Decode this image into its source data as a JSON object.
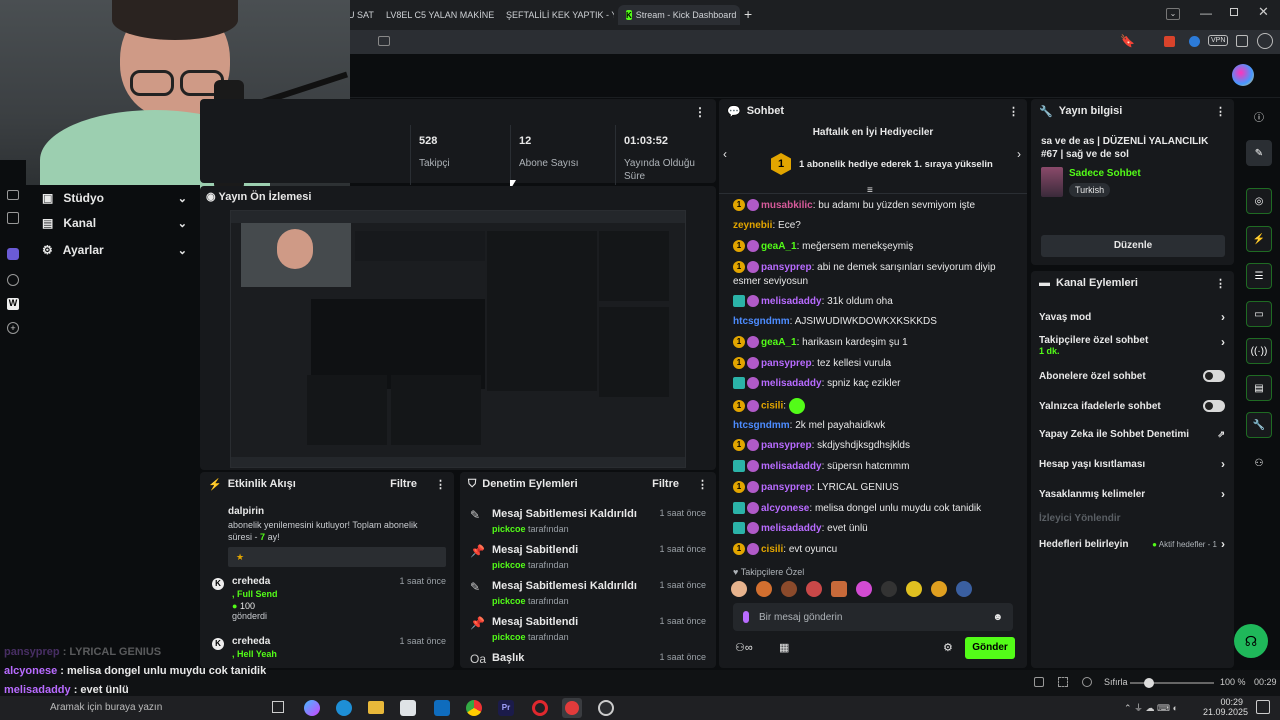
{
  "browser": {
    "tabs": [
      {
        "label": "U SAT"
      },
      {
        "label": "LV8EL C5 YALAN MAKİNESİ"
      },
      {
        "label": "ŞEFTALİLİ KEK YAPTIK - You"
      },
      {
        "label": "Stream - Kick Dashboard"
      }
    ],
    "new_tab": "+",
    "vpn_label": "VPN"
  },
  "sidenav": {
    "items": [
      {
        "label": "Stüdyo"
      },
      {
        "label": "Kanal"
      },
      {
        "label": "Ayarlar"
      }
    ]
  },
  "stats": {
    "items": [
      {
        "value": "528",
        "label": "Takipçi"
      },
      {
        "value": "12",
        "label": "Abone Sayısı"
      },
      {
        "value": "01:03:52",
        "label": "Yayında Olduğu Süre"
      }
    ]
  },
  "preview": {
    "title": "Yayın Ön İzlemesi"
  },
  "activity": {
    "title": "Etkinlik Akışı",
    "filter": "Filtre",
    "events": [
      {
        "user": "dalpirin",
        "text": "abonelik yenilemesini kutluyor! Toplam abonelik süresi -",
        "highlight": "7",
        "suffix": "ay!",
        "time": ""
      },
      {
        "user": "creheda",
        "sub": ", Full Send",
        "amount": "100",
        "amount_label": "gönderdi",
        "time": "1 saat önce"
      },
      {
        "user": "creheda",
        "sub": ", Hell Yeah",
        "time": "1 saat önce"
      }
    ]
  },
  "moderation": {
    "title": "Denetim Eylemleri",
    "filter": "Filtre",
    "actor": "pickcoe",
    "by": "tarafından",
    "items": [
      {
        "title": "Mesaj Sabitlemesi Kaldırıldı",
        "time": "1 saat önce"
      },
      {
        "title": "Mesaj Sabitlendi",
        "time": "1 saat önce"
      },
      {
        "title": "Mesaj Sabitlemesi Kaldırıldı",
        "time": "1 saat önce"
      },
      {
        "title": "Mesaj Sabitlendi",
        "time": "1 saat önce"
      },
      {
        "title": "Başlık",
        "time": "1 saat önce"
      }
    ]
  },
  "chat": {
    "title": "Sohbet",
    "gifters_title": "Haftalık en İyi Hediyeciler",
    "gift_badge": "1",
    "gift_prompt": "1 abonelik hediye ederek 1. sıraya yükselin",
    "messages": [
      {
        "badge": "sub",
        "user": "musabkilic",
        "color": "#d65a9a",
        "text": "bu adamı bu yüzden sevmiyom işte"
      },
      {
        "badge": "",
        "user": "zeynebii",
        "color": "#e2a500",
        "text": "Ece?"
      },
      {
        "badge": "sub",
        "user": "geaA_1",
        "color": "#53fc18",
        "text": "meğersem menekşeymiş"
      },
      {
        "badge": "sub",
        "user": "pansyprep",
        "color": "#b86bff",
        "text": "abi ne demek sarışınları seviyorum diyip esmer seviyosun"
      },
      {
        "badge": "mod",
        "user": "melisadaddy",
        "color": "#b86bff",
        "text": "31k oldum oha"
      },
      {
        "badge": "",
        "user": "htcsgndmm",
        "color": "#4d8cff",
        "text": "AJSIWUDIWKDOWKXKSKKDS"
      },
      {
        "badge": "sub",
        "user": "geaA_1",
        "color": "#53fc18",
        "text": "harikasın kardeşim şu 1"
      },
      {
        "badge": "sub",
        "user": "pansyprep",
        "color": "#b86bff",
        "text": "tez kellesi vurula"
      },
      {
        "badge": "mod",
        "user": "melisadaddy",
        "color": "#b86bff",
        "text": "spniz kaç ezikler"
      },
      {
        "badge": "sub",
        "user": "cisili",
        "color": "#e2a500",
        "text": ""
      },
      {
        "badge": "",
        "user": "htcsgndmm",
        "color": "#4d8cff",
        "text": "2k mel payahaidkwk"
      },
      {
        "badge": "sub",
        "user": "pansyprep",
        "color": "#b86bff",
        "text": "skdjyshdjksgdhsjklds"
      },
      {
        "badge": "mod",
        "user": "melisadaddy",
        "color": "#b86bff",
        "text": "süpersn hatcmmm"
      },
      {
        "badge": "sub",
        "user": "pansyprep",
        "color": "#b86bff",
        "text": "LYRICAL GENIUS"
      },
      {
        "badge": "mod",
        "user": "alcyonese",
        "color": "#b86bff",
        "text": "melisa dongel unlu muydu cok tanidik"
      },
      {
        "badge": "mod",
        "user": "melisadaddy",
        "color": "#b86bff",
        "text": "evet ünlü"
      },
      {
        "badge": "sub",
        "user": "cisili",
        "color": "#e2a500",
        "text": "evt oyuncu"
      }
    ],
    "followers_label": "Takipçilere Özel",
    "input_placeholder": "Bir mesaj gönderin",
    "send": "Gönder"
  },
  "stream_info": {
    "title": "Yayın bilgisi",
    "stream_title": "sa ve de as | DÜZENLİ YALANCILIK #67 | sağ ve de sol",
    "category": "Sadece Sohbet",
    "language": "Turkish",
    "edit": "Düzenle"
  },
  "channel_actions": {
    "title": "Kanal Eylemleri",
    "rows": [
      {
        "label": "Yavaş mod",
        "control": "chevron",
        "sub": ""
      },
      {
        "label": "Takipçilere özel sohbet",
        "control": "chevron",
        "sub": "1 dk."
      },
      {
        "label": "Abonelere özel sohbet",
        "control": "toggle",
        "sub": ""
      },
      {
        "label": "Yalnızca ifadelerle sohbet",
        "control": "toggle",
        "sub": ""
      },
      {
        "label": "Yapay Zeka ile Sohbet Denetimi",
        "control": "external",
        "sub": ""
      },
      {
        "label": "Hesap yaşı kısıtlaması",
        "control": "chevron",
        "sub": ""
      },
      {
        "label": "Yasaklanmış kelimeler",
        "control": "chevron",
        "sub": ""
      },
      {
        "label": "İzleyici Yönlendir",
        "control": "disabled",
        "sub": ""
      },
      {
        "label": "Hedefleri belirleyin",
        "control": "goals",
        "sub": ""
      }
    ],
    "goals_label": "Aktif hedefler - 1"
  },
  "overlay_chat": [
    {
      "user": "pansyprep",
      "text": "LYRICAL GENIUS"
    },
    {
      "user": "alcyonese",
      "text": "melisa dongel unlu muydu cok tanidik"
    },
    {
      "user": "melisadaddy",
      "text": "evet ünlü"
    },
    {
      "user": "cisili",
      "text": "evt oyuncu"
    }
  ],
  "status": {
    "reset": "Sıfırla",
    "zoom": "100 %",
    "time": "00:29"
  },
  "taskbar": {
    "search": "Aramak için buraya yazın",
    "time": "00:29",
    "date": "21.09.2025"
  },
  "colors": {
    "accent": "#53fc18",
    "panel": "#17191c",
    "bg": "#0b0d0f"
  }
}
